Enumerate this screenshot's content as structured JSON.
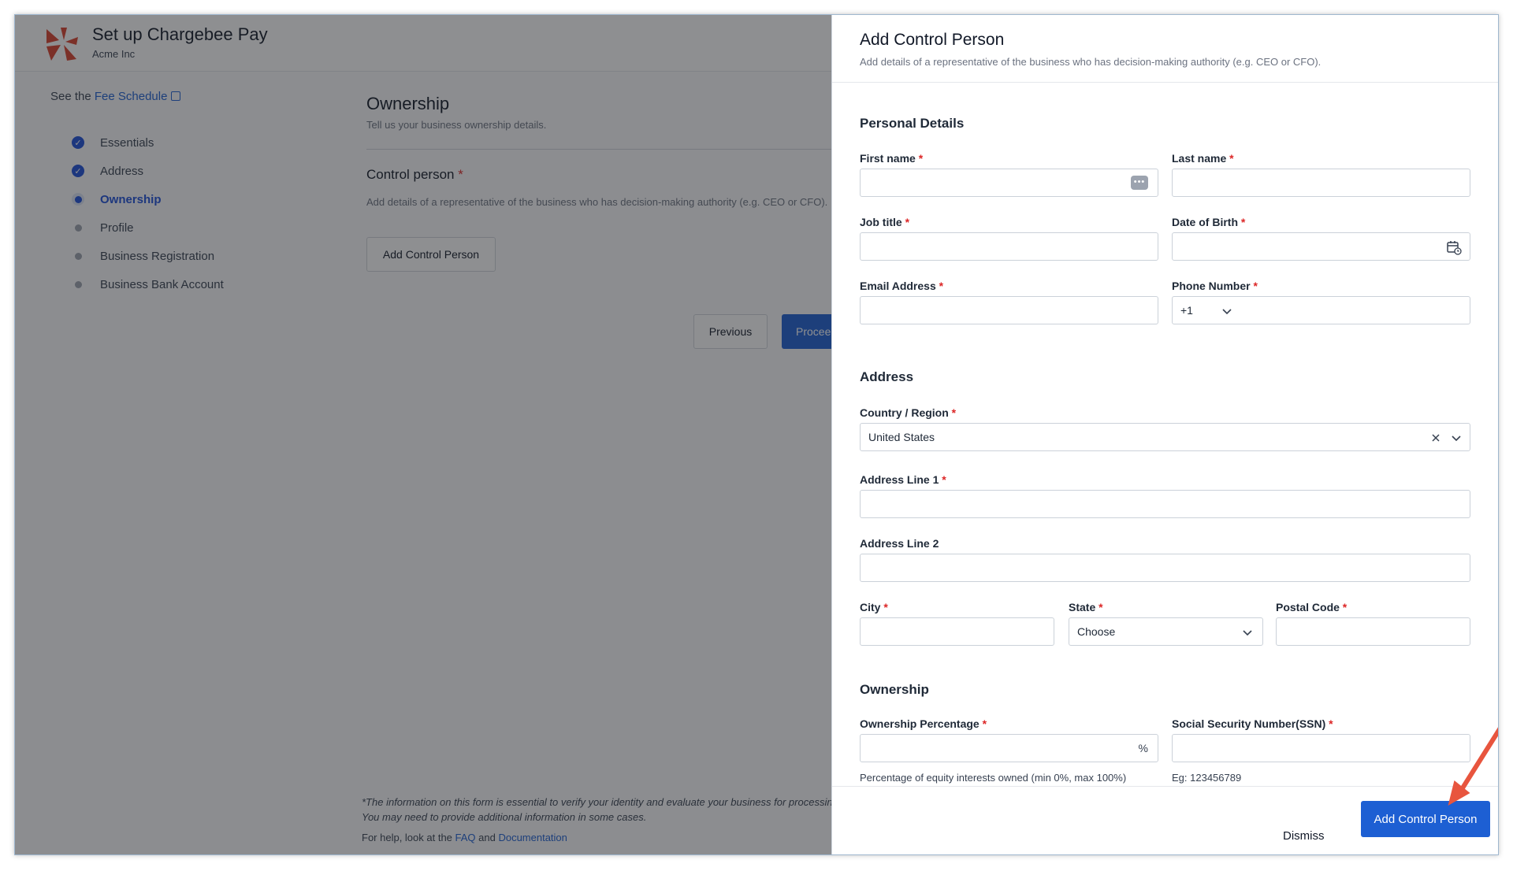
{
  "app": {
    "title": "Set up Chargebee Pay",
    "org": "Acme Inc",
    "brand_color": "#d9412d",
    "accent": "#1d5fd3"
  },
  "sidebar": {
    "fee_prefix": "See the ",
    "fee_link": "Fee Schedule",
    "steps": [
      {
        "label": "Essentials",
        "state": "done"
      },
      {
        "label": "Address",
        "state": "done"
      },
      {
        "label": "Ownership",
        "state": "current"
      },
      {
        "label": "Profile",
        "state": "todo"
      },
      {
        "label": "Business Registration",
        "state": "todo"
      },
      {
        "label": "Business Bank Account",
        "state": "todo"
      }
    ]
  },
  "main": {
    "title": "Ownership",
    "subtitle": "Tell us your business ownership details.",
    "control_title": "Control person",
    "control_desc": "Add details of a representative of the business who has decision-making authority (e.g. CEO or CFO).",
    "add_button": "Add Control Person",
    "prev_button": "Previous",
    "proceed_button": "Proceed",
    "footnote": "*The information on this form is essential to verify your identity and evaluate your business for processing. You may need to provide additional information in some cases.",
    "help_prefix": "For help, look at the ",
    "help_faq": "FAQ",
    "help_and": " and ",
    "help_docs": "Documentation"
  },
  "panel": {
    "title": "Add Control Person",
    "subtitle": "Add details of a representative of the business who has decision-making authority (e.g. CEO or CFO).",
    "personal": {
      "title": "Personal Details",
      "first_name": "First name",
      "last_name": "Last name",
      "job_title": "Job title",
      "dob": "Date of Birth",
      "email": "Email Address",
      "phone": "Phone Number",
      "phone_code": "+1"
    },
    "address": {
      "title": "Address",
      "country_label": "Country / Region",
      "country_value": "United States",
      "line1": "Address Line 1",
      "line2": "Address Line 2",
      "city": "City",
      "state": "State",
      "state_value": "Choose",
      "postal": "Postal Code"
    },
    "ownership": {
      "title": "Ownership",
      "pct_label": "Ownership Percentage",
      "pct_suffix": "%",
      "pct_hint": "Percentage of equity interests owned (min 0%, max 100%)",
      "ssn_label": "Social Security Number(SSN)",
      "ssn_hint": "Eg: 123456789"
    },
    "required_mark": "*",
    "dismiss": "Dismiss",
    "submit": "Add Control Person"
  }
}
